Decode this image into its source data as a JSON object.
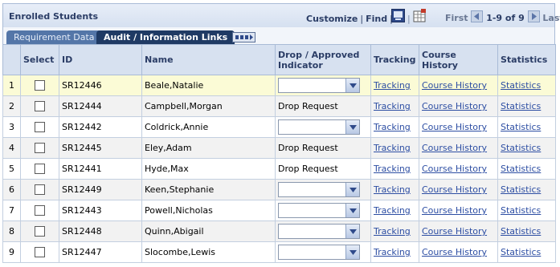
{
  "header": {
    "title": "Enrolled Students",
    "customize": "Customize",
    "find": "Find",
    "first": "First",
    "range": "1-9 of 9",
    "last": "Last"
  },
  "tabs": [
    "Requirement Data",
    "Audit / Information Links"
  ],
  "columns": {
    "num": "",
    "select": "Select",
    "id": "ID",
    "name": "Name",
    "drop": "Drop / Approved Indicator",
    "tracking": "Tracking",
    "history": "Course History",
    "statistics": "Statistics"
  },
  "rows": [
    {
      "num": "1",
      "id": "SR12446",
      "name": "Beale,Natalie",
      "drop": "",
      "tracking": "Tracking",
      "history": "Course History",
      "statistics": "Statistics"
    },
    {
      "num": "2",
      "id": "SR12444",
      "name": "Campbell,Morgan",
      "drop": "Drop Request",
      "tracking": "Tracking",
      "history": "Course History",
      "statistics": "Statistics"
    },
    {
      "num": "3",
      "id": "SR12442",
      "name": "Coldrick,Annie",
      "drop": "",
      "tracking": "Tracking",
      "history": "Course History",
      "statistics": "Statistics"
    },
    {
      "num": "4",
      "id": "SR12445",
      "name": "Eley,Adam",
      "drop": "Drop Request",
      "tracking": "Tracking",
      "history": "Course History",
      "statistics": "Statistics"
    },
    {
      "num": "5",
      "id": "SR12441",
      "name": "Hyde,Max",
      "drop": "Drop Request",
      "tracking": "Tracking",
      "history": "Course History",
      "statistics": "Statistics"
    },
    {
      "num": "6",
      "id": "SR12449",
      "name": "Keen,Stephanie",
      "drop": "",
      "tracking": "Tracking",
      "history": "Course History",
      "statistics": "Statistics"
    },
    {
      "num": "7",
      "id": "SR12443",
      "name": "Powell,Nicholas",
      "drop": "",
      "tracking": "Tracking",
      "history": "Course History",
      "statistics": "Statistics"
    },
    {
      "num": "8",
      "id": "SR12448",
      "name": "Quinn,Abigail",
      "drop": "",
      "tracking": "Tracking",
      "history": "Course History",
      "statistics": "Statistics"
    },
    {
      "num": "9",
      "id": "SR12447",
      "name": "Slocombe,Lewis",
      "drop": "",
      "tracking": "Tracking",
      "history": "Course History",
      "statistics": "Statistics"
    }
  ]
}
